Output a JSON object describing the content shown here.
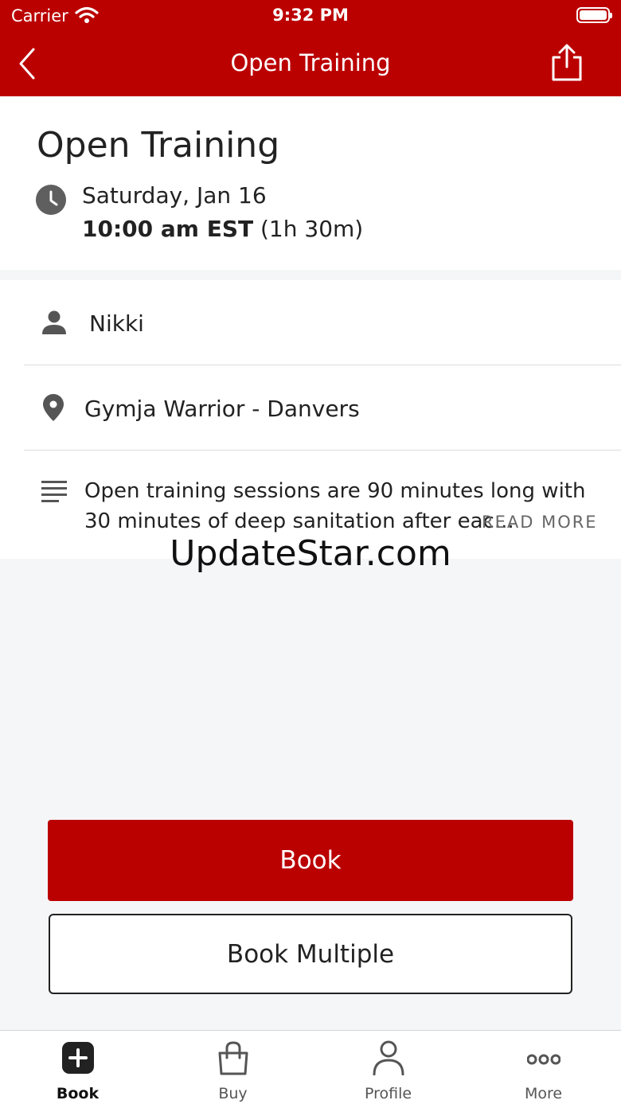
{
  "status_bar": {
    "carrier": "Carrier",
    "time": "9:32 PM"
  },
  "nav": {
    "title": "Open Training"
  },
  "class_info": {
    "title": "Open Training",
    "date": "Saturday, Jan 16",
    "time": "10:00 am EST",
    "duration": "(1h 30m)"
  },
  "details": {
    "instructor": "Nikki",
    "location": "Gymja Warrior - Danvers",
    "description": "Open training sessions are 90 minutes long with 30 minutes of deep sanitation after eac...",
    "read_more": "READ MORE"
  },
  "watermark": "UpdateStar.com",
  "actions": {
    "book": "Book",
    "book_multiple": "Book Multiple"
  },
  "tabs": [
    {
      "label": "Book",
      "icon": "plus-square-icon",
      "active": true
    },
    {
      "label": "Buy",
      "icon": "shopping-bag-icon",
      "active": false
    },
    {
      "label": "Profile",
      "icon": "person-icon",
      "active": false
    },
    {
      "label": "More",
      "icon": "ellipsis-icon",
      "active": false
    }
  ],
  "colors": {
    "brand": "#bb0000",
    "background": "#f5f6f8"
  }
}
